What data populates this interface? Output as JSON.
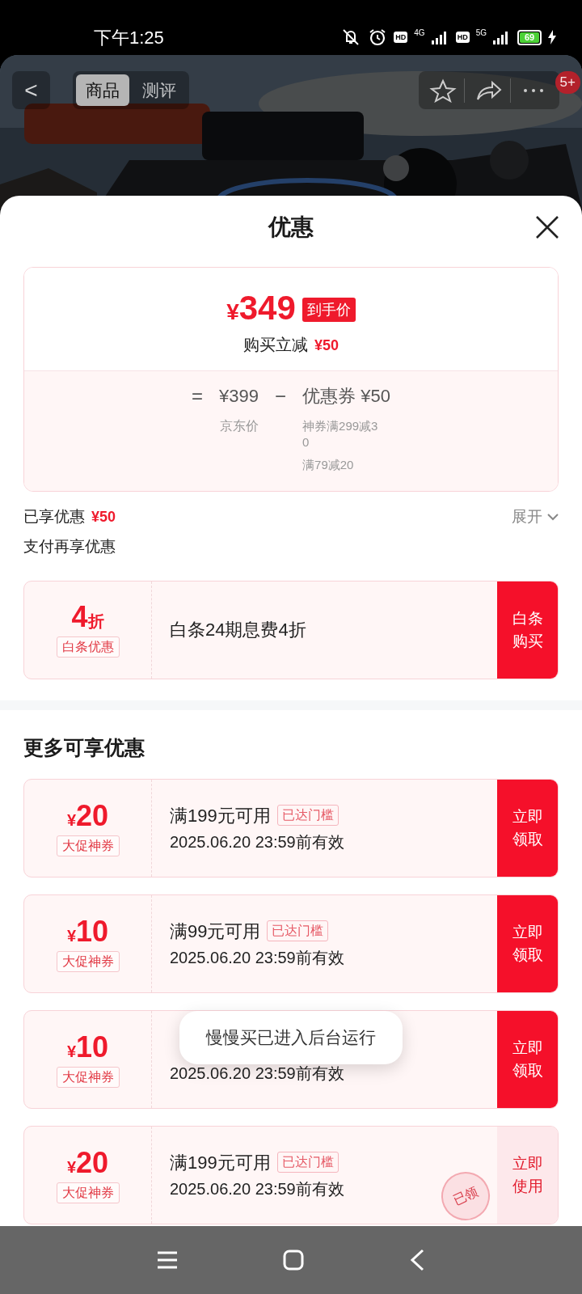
{
  "status_bar": {
    "time": "下午1:25",
    "hd_1": "HD",
    "network_1": "4G",
    "hd_2": "HD",
    "network_2": "5G",
    "battery": "69"
  },
  "header": {
    "back": "<",
    "tabs": [
      {
        "label": "商品",
        "selected": true
      },
      {
        "label": "测评",
        "selected": false
      }
    ],
    "badge": "5+"
  },
  "sheet": {
    "title": "优惠",
    "price_card": {
      "symbol": "¥",
      "price": "349",
      "price_tag": "到手价",
      "saving_label": "购买立减",
      "saving": "¥50",
      "breakdown": {
        "equals": "=",
        "base_price": "¥399",
        "base_label": "京东价",
        "minus": "−",
        "coupon_total": "优惠券 ¥50",
        "coupon_items": [
          "神券满299减30",
          "满79减20"
        ]
      }
    },
    "enjoyed": {
      "label": "已享优惠",
      "amount": "¥50",
      "toggle": "展开",
      "expanded": false
    },
    "pay_section": {
      "title": "支付再享优惠",
      "offer": {
        "value": "4",
        "unit": "折",
        "tag": "白条优惠",
        "description": "白条24期息费4折",
        "button": "白条购买"
      }
    },
    "more_section": {
      "title": "更多可享优惠",
      "coupons": [
        {
          "symbol": "¥",
          "value": "20",
          "tag": "大促神券",
          "condition": "满199元可用",
          "badge": "已达门槛",
          "validity": "2025.06.20 23:59前有效",
          "button": "立即领取",
          "claimed": false
        },
        {
          "symbol": "¥",
          "value": "10",
          "tag": "大促神券",
          "condition": "满99元可用",
          "badge": "已达门槛",
          "validity": "2025.06.20 23:59前有效",
          "button": "立即领取",
          "claimed": false
        },
        {
          "symbol": "¥",
          "value": "10",
          "tag": "大促神券",
          "validity": "2025.06.20 23:59前有效",
          "button": "立即领取",
          "claimed": false
        },
        {
          "symbol": "¥",
          "value": "20",
          "tag": "大促神券",
          "condition": "满199元可用",
          "badge": "已达门槛",
          "validity": "2025.06.20 23:59前有效",
          "button": "立即使用",
          "claimed": true,
          "stamp": "已领"
        }
      ]
    }
  },
  "toast": "慢慢买已进入后台运行"
}
